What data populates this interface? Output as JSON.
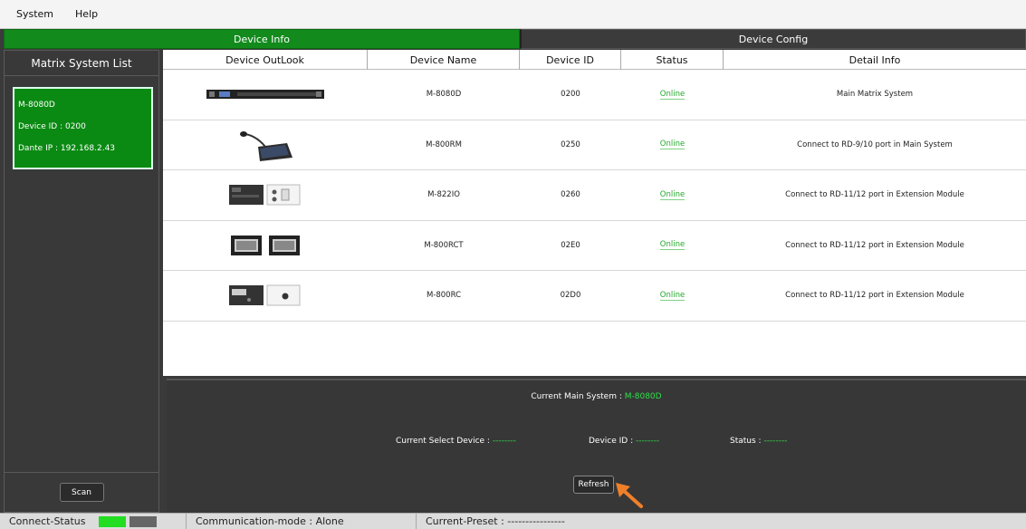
{
  "menu": {
    "items": [
      "System",
      "Help"
    ]
  },
  "tabs": {
    "device_info": "Device Info",
    "device_config": "Device Config"
  },
  "left_panel": {
    "title": "Matrix System List",
    "system": {
      "name": "M-8080D",
      "device_id": "Device ID : 0200",
      "dante_ip": "Dante IP : 192.168.2.43"
    },
    "scan_label": "Scan"
  },
  "table": {
    "headers": [
      "Device OutLook",
      "Device Name",
      "Device ID",
      "Status",
      "Detail Info"
    ],
    "rows": [
      {
        "name": "M-8080D",
        "id": "0200",
        "status": "Online",
        "detail": "Main Matrix System"
      },
      {
        "name": "M-800RM",
        "id": "0250",
        "status": "Online",
        "detail": "Connect to RD-9/10 port in Main System"
      },
      {
        "name": "M-822IO",
        "id": "0260",
        "status": "Online",
        "detail": "Connect to RD-11/12 port in Extension Module"
      },
      {
        "name": "M-800RCT",
        "id": "02E0",
        "status": "Online",
        "detail": "Connect to RD-11/12 port in Extension Module"
      },
      {
        "name": "M-800RC",
        "id": "02D0",
        "status": "Online",
        "detail": "Connect to RD-11/12 port in Extension Module"
      }
    ]
  },
  "bottom_panel": {
    "current_main_label": "Current Main System :",
    "current_main_value": "M-8080D",
    "select_device_label": "Current Select Device :",
    "select_device_value": "--------",
    "device_id_label": "Device ID :",
    "device_id_value": "--------",
    "status_label": "Status :",
    "status_value": "--------",
    "refresh_label": "Refresh"
  },
  "status_bar": {
    "connect_status": "Connect-Status",
    "communication_mode": "Communication-mode : Alone",
    "current_preset": "Current-Preset : ----------------",
    "connected_color": "#22dd22",
    "idle_color": "#666666"
  }
}
